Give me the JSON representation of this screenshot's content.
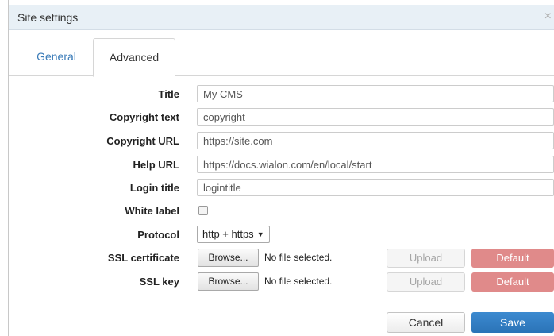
{
  "dialog": {
    "title": "Site settings",
    "close_glyph": "×"
  },
  "tabs": [
    {
      "label": "General",
      "active": false
    },
    {
      "label": "Advanced",
      "active": true
    }
  ],
  "fields": {
    "title": {
      "label": "Title",
      "value": "My CMS"
    },
    "copyright_text": {
      "label": "Copyright text",
      "value": "copyright"
    },
    "copyright_url": {
      "label": "Copyright URL",
      "value": "https://site.com"
    },
    "help_url": {
      "label": "Help URL",
      "value": "https://docs.wialon.com/en/local/start"
    },
    "login_title": {
      "label": "Login title",
      "value": "logintitle"
    },
    "white_label": {
      "label": "White label",
      "checked": false
    },
    "protocol": {
      "label": "Protocol",
      "value": "http + https",
      "arrow": "▼"
    }
  },
  "ssl_certificate": {
    "label": "SSL certificate",
    "browse_label": "Browse...",
    "status": "No file selected.",
    "upload_label": "Upload",
    "default_label": "Default"
  },
  "ssl_key": {
    "label": "SSL key",
    "browse_label": "Browse...",
    "status": "No file selected.",
    "upload_label": "Upload",
    "default_label": "Default"
  },
  "footer": {
    "cancel_label": "Cancel",
    "save_label": "Save"
  },
  "colors": {
    "titlebar_bg": "#e8f0f6",
    "link_blue": "#3a7bb8",
    "save_blue": "#2f7cc2",
    "default_red": "#e08a8a"
  }
}
